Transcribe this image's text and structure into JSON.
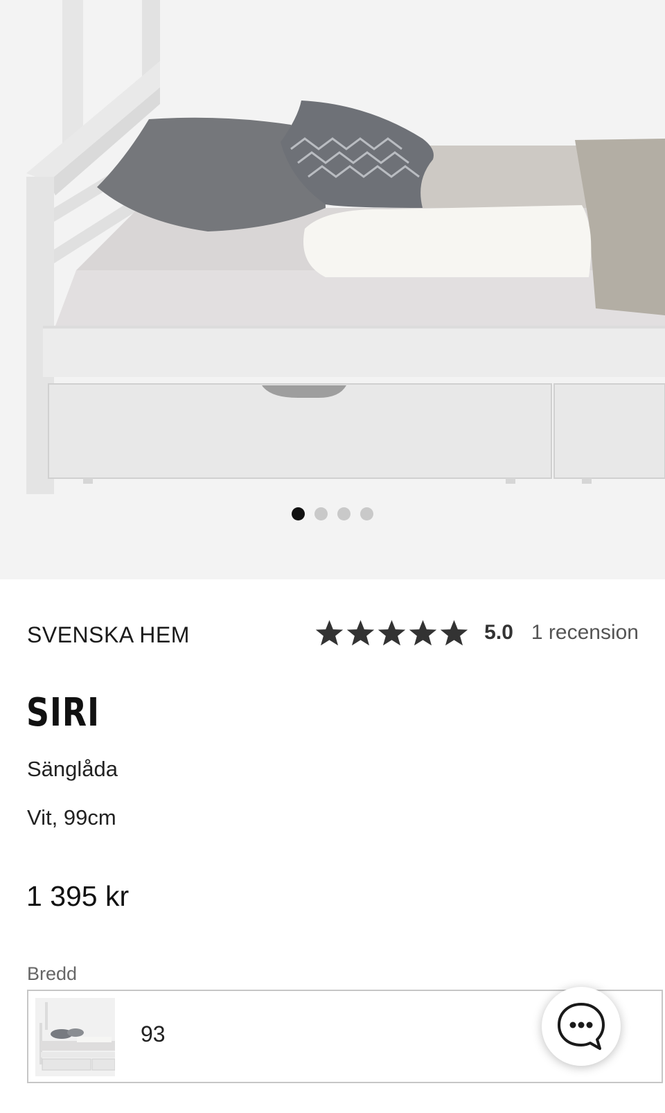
{
  "gallery": {
    "image_count": 4,
    "active_index": 0
  },
  "product": {
    "brand": "SVENSKA HEM",
    "rating": {
      "stars": 5,
      "score": "5.0",
      "reviews_label": "1 recension"
    },
    "name": "SIRI",
    "type": "Sänglåda",
    "variant": "Vit, 99cm",
    "price": "1 395 kr"
  },
  "width_selector": {
    "label": "Bredd",
    "selected_value": "93"
  },
  "chat": {
    "icon": "chat-bubble-icon"
  },
  "colors": {
    "star": "#333333",
    "dot_active": "#111111",
    "dot_inactive": "#c9c9c9",
    "image_background": "#f3f3f3"
  }
}
